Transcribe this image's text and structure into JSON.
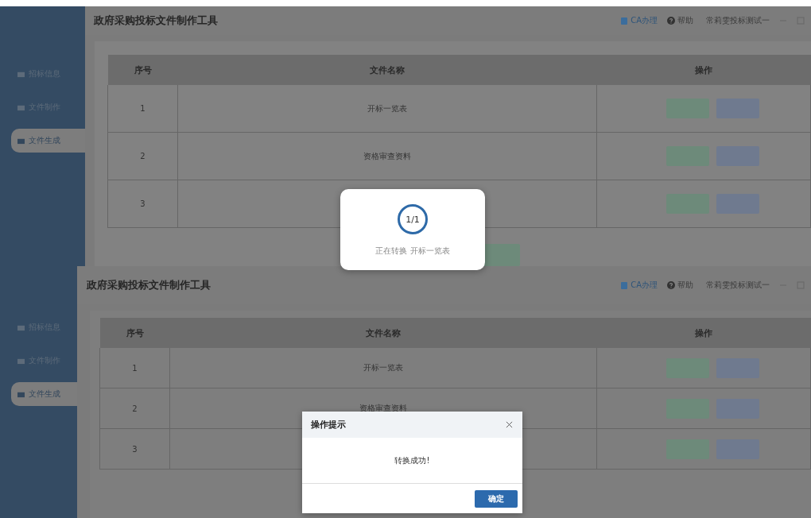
{
  "screens": [
    {
      "app_title": "政府采购投标文件制作工具",
      "toolbar": {
        "ca": "CA办理",
        "help": "帮助",
        "user": "常莉雯投标测试一"
      },
      "sidebar": [
        {
          "label": "招标信息",
          "selected": false
        },
        {
          "label": "文件制作",
          "selected": false
        },
        {
          "label": "文件生成",
          "selected": true
        }
      ],
      "table": {
        "columns": [
          "序号",
          "文件名称",
          "操作"
        ],
        "rows": [
          {
            "index": "1",
            "name": "开标一览表",
            "actions": [
              {
                "kind": "success"
              },
              {
                "kind": "info"
              }
            ]
          },
          {
            "index": "2",
            "name": "资格审查资料",
            "actions": [
              {
                "kind": "success"
              },
              {
                "kind": "info"
              }
            ]
          },
          {
            "index": "3",
            "actions": [
              {
                "kind": "success"
              },
              {
                "kind": "info"
              }
            ]
          }
        ]
      },
      "footer_buttons": [
        {
          "kind": "success"
        }
      ]
    },
    {
      "app_title": "政府采购投标文件制作工具",
      "toolbar": {
        "ca": "CA办理",
        "help": "帮助",
        "user": "常莉雯投标测试一"
      },
      "sidebar": [
        {
          "label": "招标信息",
          "selected": false
        },
        {
          "label": "文件制作",
          "selected": false
        },
        {
          "label": "文件生成",
          "selected": true
        }
      ],
      "table": {
        "columns": [
          "序号",
          "文件名称",
          "操作"
        ],
        "rows": [
          {
            "index": "1",
            "name": "开标一览表",
            "actions": [
              {
                "kind": "success"
              },
              {
                "kind": "info"
              }
            ]
          },
          {
            "index": "2",
            "name": "资格审查资料",
            "actions": [
              {
                "kind": "success"
              },
              {
                "kind": "info"
              }
            ]
          },
          {
            "index": "3",
            "actions": [
              {
                "kind": "success"
              },
              {
                "kind": "info"
              }
            ]
          }
        ]
      }
    }
  ],
  "loading_dialog": {
    "progress": "1/1",
    "message": "正在转换 开标一览表"
  },
  "alert_dialog": {
    "title": "操作提示",
    "message": "转换成功!",
    "confirm": "确定"
  }
}
